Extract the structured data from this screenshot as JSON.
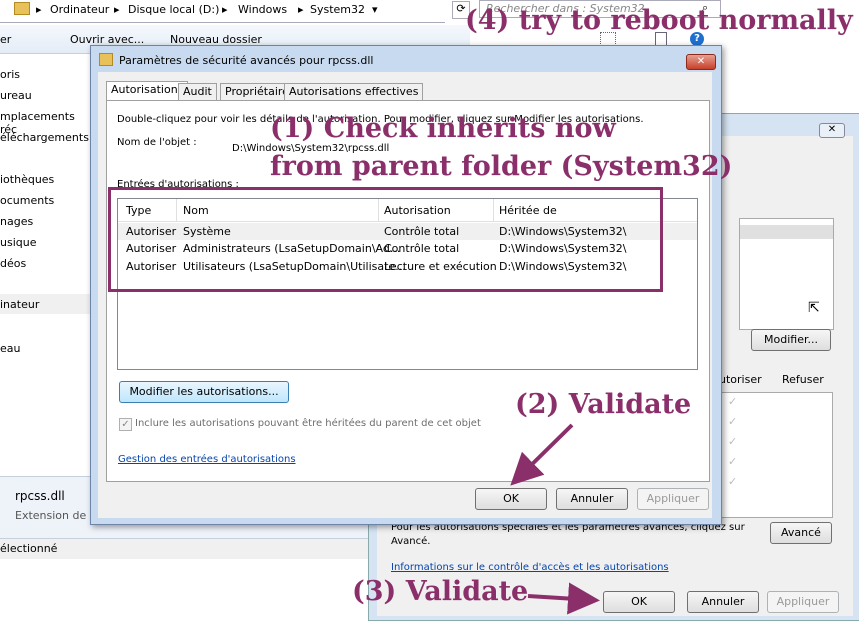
{
  "explorer": {
    "breadcrumb": [
      "Ordinateur",
      "Disque local (D:)",
      "Windows",
      "System32"
    ],
    "search_placeholder": "Rechercher dans : System32",
    "toolbar": {
      "organize": "er",
      "open_with": "Ouvrir avec...",
      "new_folder": "Nouveau dossier"
    },
    "nav_items": [
      "oris",
      "ureau",
      "mplacements réc",
      "éléchargements",
      "iothèques",
      "ocuments",
      "nages",
      "usique",
      "déos",
      "inateur",
      "eau"
    ],
    "file_name": "rpcss.dll",
    "file_type": "Extension de l'",
    "status": "électionné"
  },
  "dialog": {
    "title": "Paramètres de sécurité avancés pour rpcss.dll",
    "tabs": [
      "Autorisations",
      "Audit",
      "Propriétaire",
      "Autorisations effectives"
    ],
    "instruction": "Double-cliquez pour voir les détails de l'autorisation. Pour modifier, cliquez sur Modifier les autorisations.",
    "object_label": "Nom de l'objet :",
    "object_value": "D:\\Windows\\System32\\rpcss.dll",
    "entries_label": "Entrées d'autorisations :",
    "columns": [
      "Type",
      "Nom",
      "Autorisation",
      "Héritée de"
    ],
    "rows": [
      [
        "Autoriser",
        "Système",
        "Contrôle total",
        "D:\\Windows\\System32\\"
      ],
      [
        "Autoriser",
        "Administrateurs (LsaSetupDomain\\Ad...",
        "Contrôle total",
        "D:\\Windows\\System32\\"
      ],
      [
        "Autoriser",
        "Utilisateurs (LsaSetupDomain\\Utilisate...",
        "Lecture et exécution",
        "D:\\Windows\\System32\\"
      ]
    ],
    "modify_button": "Modifier les autorisations...",
    "inherit_checkbox": "Inclure les autorisations pouvant être héritées du parent de cet objet",
    "inherit_checked": true,
    "manage_link": "Gestion des entrées d'autorisations",
    "ok": "OK",
    "cancel": "Annuler",
    "apply": "Appliquer"
  },
  "back_dialog": {
    "modify_button": "Modifier...",
    "allow_header": "utoriser",
    "deny_header": "Refuser",
    "advanced_text_1": "Pour les autorisations spéciales et les paramètres avancés, cliquez sur",
    "advanced_text_2": "Avancé.",
    "advanced_button": "Avancé",
    "info_link": "Informations sur le contrôle d'accès et les autorisations",
    "ok": "OK",
    "cancel": "Annuler",
    "apply": "Appliquer"
  },
  "annotations": {
    "step1_line1": "(1) Check inherits now",
    "step1_line2": "from parent folder (System32)",
    "step2": "(2) Validate",
    "step3": "(3) Validate",
    "step4": "(4) try to reboot normally"
  },
  "colors": {
    "annotation": "#8b2f6b",
    "link": "#0645ad",
    "dialog_bg": "#f0f0f0"
  }
}
